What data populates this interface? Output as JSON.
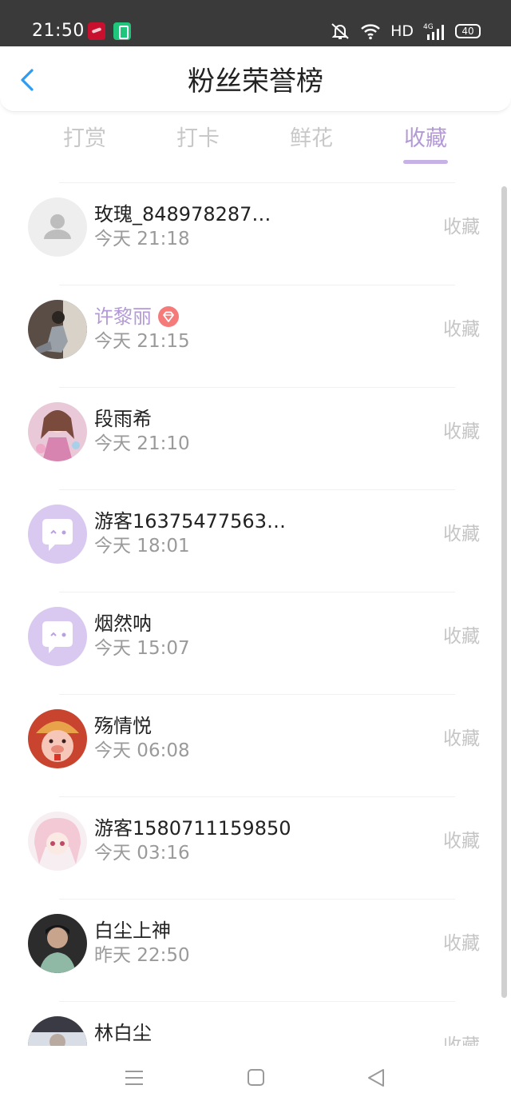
{
  "status_bar": {
    "time": "21:50",
    "network_label": "HD",
    "signal_label": "4G",
    "battery_level": "40"
  },
  "header": {
    "title": "粉丝荣誉榜"
  },
  "tabs": [
    {
      "label": "打赏",
      "active": false
    },
    {
      "label": "打卡",
      "active": false
    },
    {
      "label": "鲜花",
      "active": false
    },
    {
      "label": "收藏",
      "active": true
    }
  ],
  "list": [
    {
      "name": "玫瑰_848978287…",
      "time": "今天 21:18",
      "action": "收藏",
      "avatar": "default-user-icon"
    },
    {
      "name": "许黎丽",
      "time": "今天 21:15",
      "action": "收藏",
      "avatar": "photo",
      "vip": true
    },
    {
      "name": "段雨希",
      "time": "今天 21:10",
      "action": "收藏",
      "avatar": "anime-girl"
    },
    {
      "name": "游客16375477563…",
      "time": "今天 18:01",
      "action": "收藏",
      "avatar": "chat-bubble-icon"
    },
    {
      "name": "烟然呐",
      "time": "今天 15:07",
      "action": "收藏",
      "avatar": "chat-bubble-icon"
    },
    {
      "name": "殇情悦",
      "time": "今天 06:08",
      "action": "收藏",
      "avatar": "cartoon-pig"
    },
    {
      "name": "游客1580711159850",
      "time": "今天 03:16",
      "action": "收藏",
      "avatar": "anime-girl-pink"
    },
    {
      "name": "白尘上神",
      "time": "昨天 22:50",
      "action": "收藏",
      "avatar": "photo-man"
    },
    {
      "name": "林白尘",
      "time": "",
      "action": "收藏",
      "avatar": "photo"
    }
  ],
  "colors": {
    "accent": "#b39ad6",
    "back": "#2f9cf0",
    "status_bar": "#3a3a3a"
  }
}
